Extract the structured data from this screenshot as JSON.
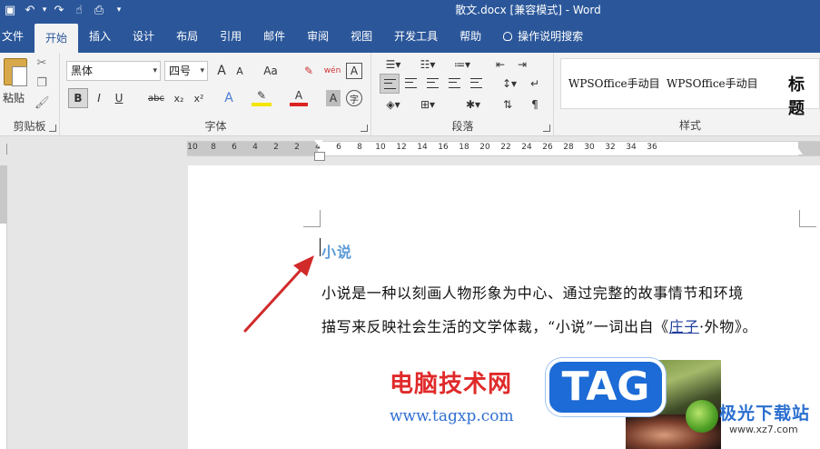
{
  "title_bar": {
    "document_title": "散文.docx [兼容模式] - Word",
    "quick_access": [
      "save-icon",
      "undo-icon",
      "redo-icon",
      "touch-mode-icon",
      "print-preview-icon",
      "customize-icon"
    ],
    "undo_glyph": "↶",
    "redo_glyph": "↷",
    "save_glyph": "▣",
    "more_glyph": "▾"
  },
  "tabs": [
    "文件",
    "开始",
    "插入",
    "设计",
    "布局",
    "引用",
    "邮件",
    "审阅",
    "视图",
    "开发工具",
    "帮助"
  ],
  "active_tab": "开始",
  "tell_me": "操作说明搜索",
  "ribbon": {
    "clipboard": {
      "paste_label": "粘贴",
      "group_label": "剪贴板"
    },
    "font": {
      "font_name": "黑体",
      "font_size": "四号",
      "bold": "B",
      "italic": "I",
      "underline": "U",
      "strike": "abc",
      "subscript": "x₂",
      "superscript": "x²",
      "change_case": "Aa",
      "grow": "A",
      "shrink": "A",
      "phonetic": "wén",
      "border_char": "A",
      "shading_char": "A",
      "enclose_char": "字",
      "group_label": "字体"
    },
    "paragraph": {
      "group_label": "段落"
    },
    "styles": {
      "items": [
        "WPSOffice手动目",
        "WPSOffice手动目"
      ],
      "title_style": "标题",
      "group_label": "样式"
    }
  },
  "ruler": {
    "ticks": [
      "10",
      "8",
      "6",
      "4",
      "2",
      "2",
      "4",
      "6",
      "8",
      "10",
      "12",
      "14",
      "16",
      "18",
      "20",
      "22",
      "24",
      "26",
      "28",
      "30",
      "32",
      "34",
      "36"
    ]
  },
  "document": {
    "heading": "小说",
    "line1": "小说是一种以刻画人物形象为中心、通过完整的故事情节和环境",
    "line2_before": "描写来反映社会生活的文学体裁，“小说”一词出自《",
    "line2_link": "庄子",
    "line2_after": "·外物》。"
  },
  "watermarks": {
    "site_name": "电脑技术网",
    "site_url": "www.tagxp.com",
    "tag_text": "TAG",
    "xz_name": "极光下载站",
    "xz_url": "www.xz7.com"
  },
  "colors": {
    "title_bar": "#2b579a",
    "heading": "#5b9bd5",
    "arrow": "#d12a2a"
  }
}
